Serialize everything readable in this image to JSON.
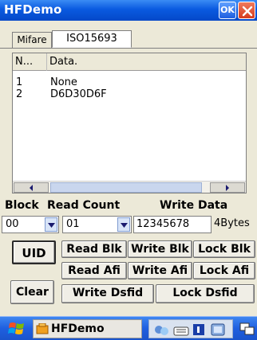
{
  "window": {
    "title": "HFDemo",
    "ok_label": "OK"
  },
  "tabs": [
    {
      "label": "Mifare",
      "active": false
    },
    {
      "label": "ISO15693",
      "active": true
    }
  ],
  "list": {
    "columns": [
      "N...",
      "Data."
    ],
    "rows": [
      {
        "n": "1",
        "data": "None"
      },
      {
        "n": "2",
        "data": "D6D30D6F"
      }
    ]
  },
  "labels": {
    "block": "Block",
    "read_count": "Read Count",
    "write_data": "Write Data"
  },
  "inputs": {
    "block_value": "00",
    "read_count_value": "01",
    "write_data_value": "12345678",
    "unit": "4Bytes"
  },
  "buttons": {
    "uid": "UID",
    "clear": "Clear",
    "read_blk": "Read Blk",
    "write_blk": "Write Blk",
    "lock_blk": "Lock Blk",
    "read_afi": "Read Afi",
    "write_afi": "Write Afi",
    "lock_afi": "Lock Afi",
    "write_dsfid": "Write Dsfid",
    "lock_dsfid": "Lock Dsfid"
  },
  "taskbar": {
    "app_label": "HFDemo"
  },
  "colors": {
    "title_blue": "#0a5ae0",
    "close_red": "#d63c1e",
    "window_bg": "#ece9d8"
  }
}
